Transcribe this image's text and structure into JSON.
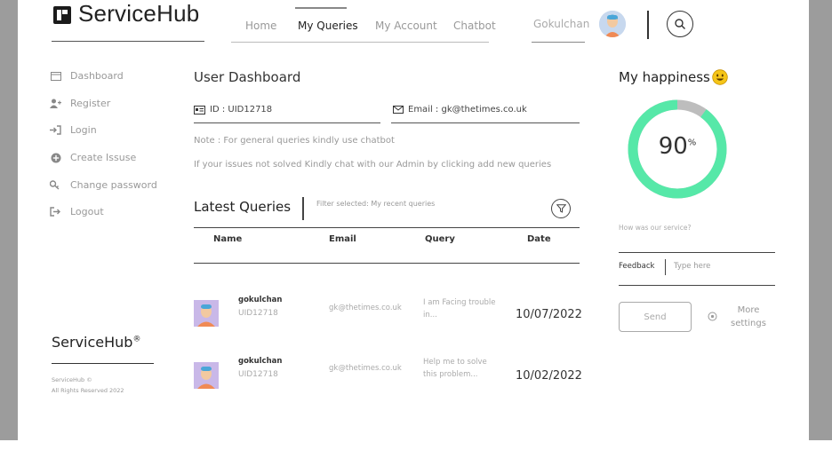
{
  "brand": {
    "name": "ServiceHub",
    "footer_name": "ServiceHub",
    "footer_mark": "®",
    "footer_line1": "ServiceHub ©",
    "footer_line2": "All Rights Reserved 2022"
  },
  "nav": {
    "items": [
      "Home",
      "My Queries",
      "My Account",
      "Chatbot"
    ],
    "active": "My Queries"
  },
  "user": {
    "name": "Gokulchan"
  },
  "sidebar": {
    "items": [
      {
        "label": "Dashboard",
        "icon": "calendar-icon"
      },
      {
        "label": "Register",
        "icon": "add-user-icon"
      },
      {
        "label": "Login",
        "icon": "login-icon"
      },
      {
        "label": "Create Issuse",
        "icon": "plus-circle-icon"
      },
      {
        "label": "Change password",
        "icon": "key-icon"
      },
      {
        "label": "Logout",
        "icon": "logout-icon"
      }
    ]
  },
  "dashboard": {
    "title": "User Dashboard",
    "id_text": "ID : UID12718",
    "email_text": "Email : gk@thetimes.co.uk",
    "note1": "Note : For general queries kindly use chatbot",
    "note2": "If your issues not solved Kindly chat with our Admin by clicking add new queries"
  },
  "queries": {
    "title": "Latest Queries",
    "filter_text": "Filter selected: My recent queries",
    "headers": [
      "Name",
      "Email",
      "Query",
      "Date"
    ],
    "rows": [
      {
        "name": "gokulchan",
        "uid": "UID12718",
        "email": "gk@thetimes.co.uk",
        "query_line1": "I am Facing trouble",
        "query_line2": "in...",
        "date": "10/07/2022"
      },
      {
        "name": "gokulchan",
        "uid": "UID12718",
        "email": "gk@thetimes.co.uk",
        "query_line1": "Help me to solve",
        "query_line2": "this problem...",
        "date": "10/02/2022"
      }
    ]
  },
  "happiness": {
    "title": "My happiness",
    "value": 90,
    "value_text": "90",
    "unit": "%",
    "ring_color": "#56e8a8",
    "rest_color": "#bdbdbd"
  },
  "feedback": {
    "question": "How was our service?",
    "label": "Feedback",
    "placeholder": "Type here",
    "send_label": "Send",
    "more_line1": "More",
    "more_line2": "settings"
  }
}
